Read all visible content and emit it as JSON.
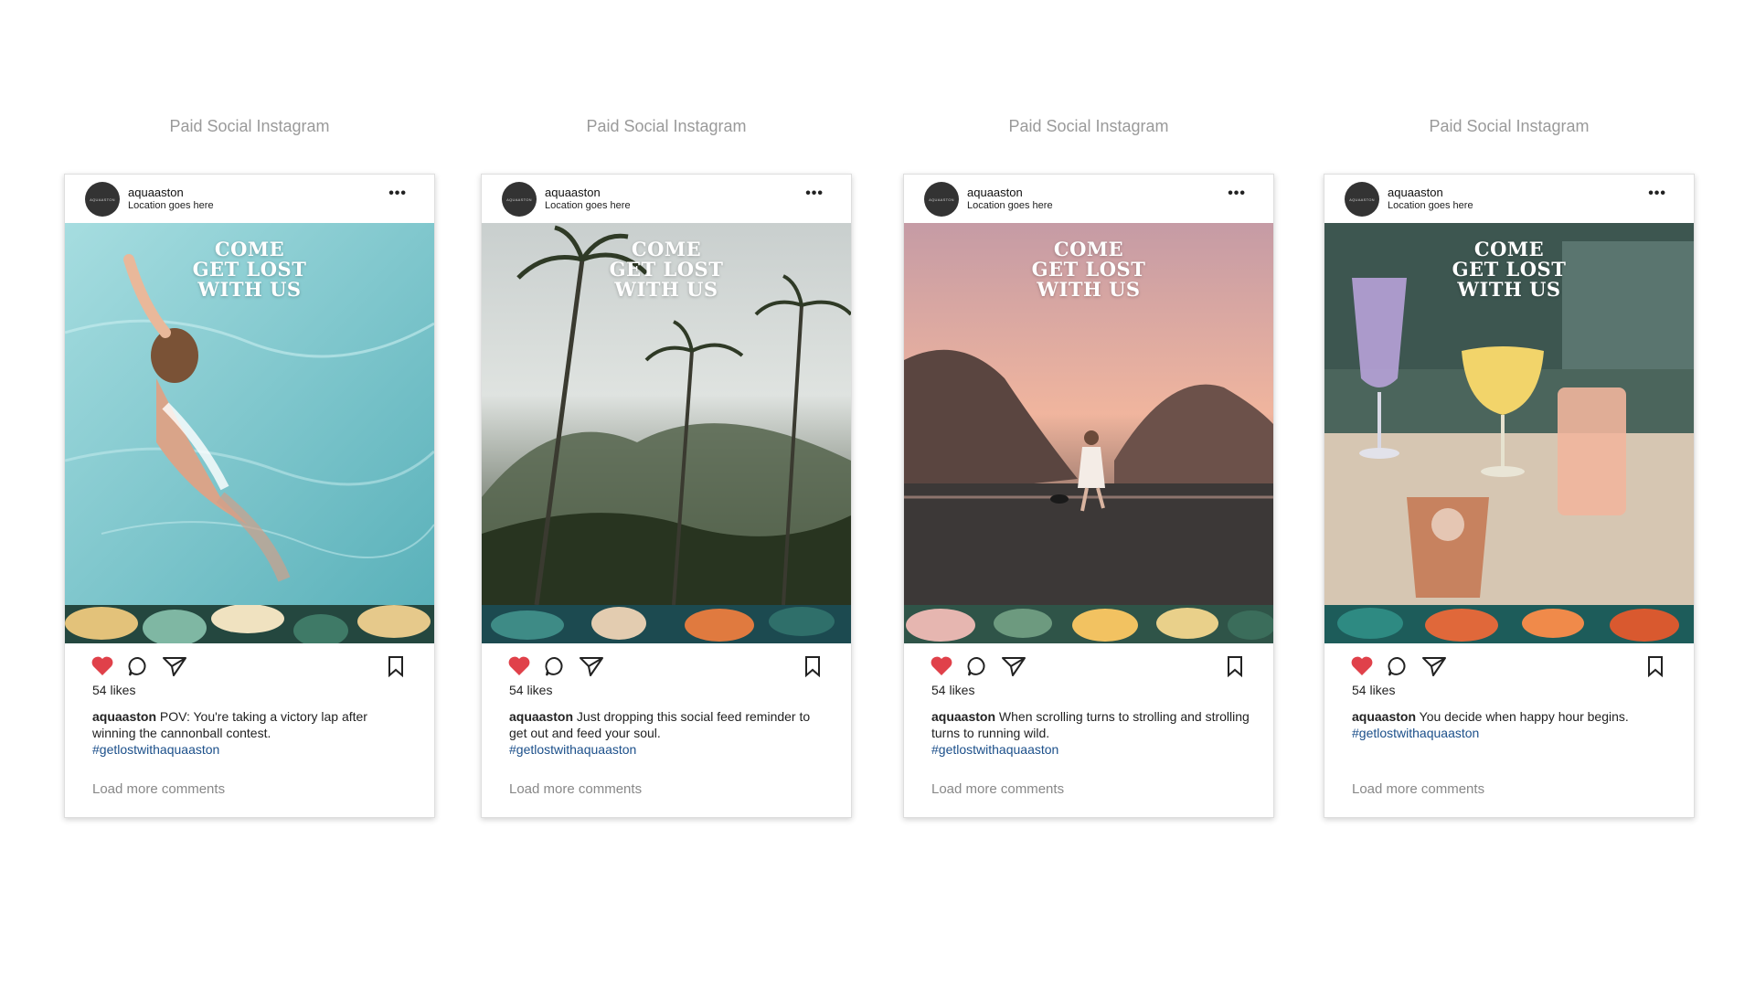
{
  "posts": [
    {
      "section_title": "Paid Social Instagram",
      "username": "aquaaston",
      "location": "Location goes here",
      "avatar_text": "AQUAASTON",
      "headline": [
        "COME",
        "GET LOST",
        "WITH US"
      ],
      "likes": "54 likes",
      "caption_user": "aquaaston",
      "caption_text": "POV: You're taking a victory lap after winning the cannonball contest.",
      "hashtag": "#getlostwithaquaaston",
      "load_more": "Load more comments",
      "scene": "swimmer-in-pool",
      "colors": {
        "top": "#8fd0d6",
        "bottom": "#5fb4bd",
        "band": "#2f5d52"
      }
    },
    {
      "section_title": "Paid Social Instagram",
      "username": "aquaaston",
      "location": "Location goes here",
      "avatar_text": "AQUAASTON",
      "headline": [
        "COME",
        "GET LOST",
        "WITH US"
      ],
      "likes": "54 likes",
      "caption_user": "aquaaston",
      "caption_text": "Just dropping this social feed reminder to get out and feed your soul.",
      "hashtag": "#getlostwithaquaaston",
      "load_more": "Load more comments",
      "scene": "palm-trees-mountains",
      "colors": {
        "top": "#d4d8d6",
        "bottom": "#3c4a32",
        "band": "#1f4f55"
      }
    },
    {
      "section_title": "Paid Social Instagram",
      "username": "aquaaston",
      "location": "Location goes here",
      "avatar_text": "AQUAASTON",
      "headline": [
        "COME",
        "GET LOST",
        "WITH US"
      ],
      "likes": "54 likes",
      "caption_user": "aquaaston",
      "caption_text": "When scrolling turns to strolling and strolling turns to running wild.",
      "hashtag": "#getlostwithaquaaston",
      "load_more": "Load more comments",
      "scene": "woman-dog-beach-sunset",
      "colors": {
        "top": "#d9a6a6",
        "bottom": "#4c4544",
        "band": "#3a5b4e"
      }
    },
    {
      "section_title": "Paid Social Instagram",
      "username": "aquaaston",
      "location": "Location goes here",
      "avatar_text": "AQUAASTON",
      "headline": [
        "COME",
        "GET LOST",
        "WITH US"
      ],
      "likes": "54 likes",
      "caption_user": "aquaaston",
      "caption_text": "You decide when happy hour begins.",
      "hashtag": "#getlostwithaquaaston",
      "load_more": "Load more comments",
      "scene": "cocktails-on-table",
      "colors": {
        "top": "#4e6b63",
        "bottom": "#d9cbb8",
        "band": "#1f5b5a"
      }
    }
  ],
  "icons": {
    "more": "more-options-icon",
    "like": "heart-icon",
    "comment": "comment-icon",
    "share": "send-icon",
    "save": "bookmark-icon"
  },
  "like_color": "#e0414a"
}
